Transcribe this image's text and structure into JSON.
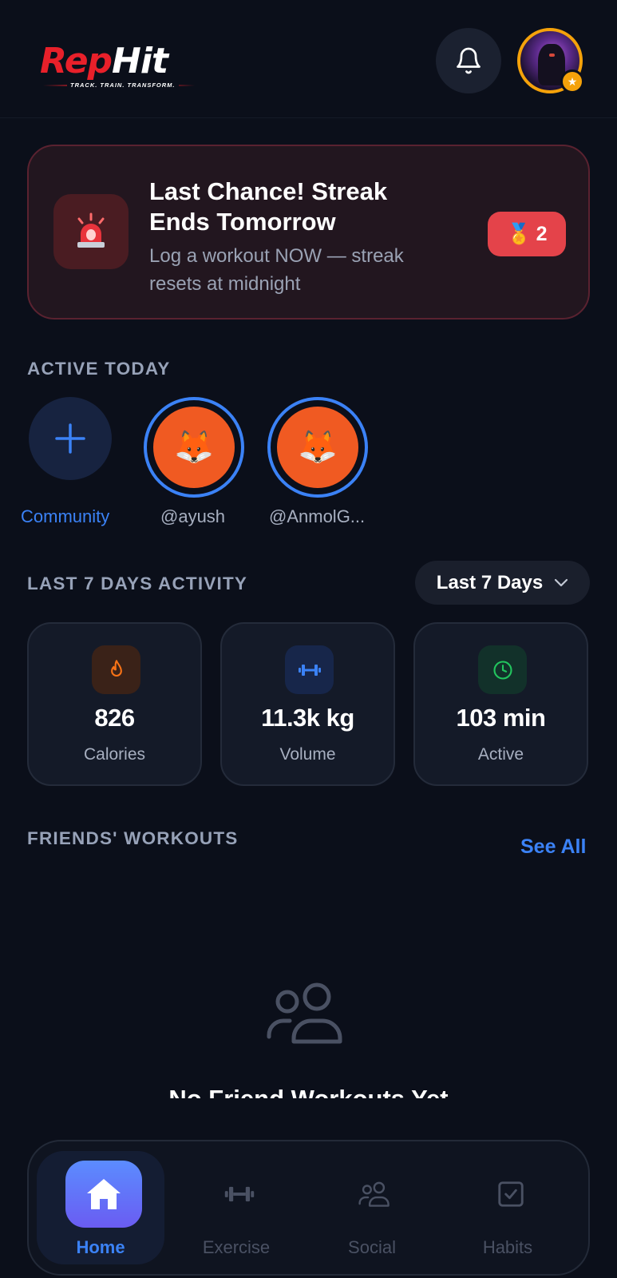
{
  "header": {
    "logo_rep": "Rep",
    "logo_hit": "Hit",
    "logo_tagline": "TRACK. TRAIN. TRANSFORM."
  },
  "alert": {
    "title": "Last Chance! Streak Ends Tomorrow",
    "subtitle": "Log a workout NOW — streak resets at midnight",
    "badge_icon": "🏅",
    "badge_count": "2"
  },
  "active_today": {
    "label": "ACTIVE TODAY",
    "stories": [
      {
        "label": "Community"
      },
      {
        "label": "@ayush",
        "emoji": "🦊"
      },
      {
        "label": "@AnmolG...",
        "emoji": "🦊"
      }
    ]
  },
  "activity": {
    "label": "LAST 7 DAYS ACTIVITY",
    "range": "Last 7 Days",
    "stats": [
      {
        "value": "826",
        "label": "Calories",
        "icon": "flame-icon",
        "color": "#f97316"
      },
      {
        "value": "11.3k kg",
        "label": "Volume",
        "icon": "dumbbell-icon",
        "color": "#3b82f6"
      },
      {
        "value": "103 min",
        "label": "Active",
        "icon": "clock-icon",
        "color": "#22c55e"
      }
    ]
  },
  "friends": {
    "label": "FRIENDS' WORKOUTS",
    "see_all": "See All",
    "empty_title": "No Friend Workouts Yet"
  },
  "nav": {
    "items": [
      {
        "label": "Home",
        "active": true
      },
      {
        "label": "Exercise",
        "active": false
      },
      {
        "label": "Social",
        "active": false
      },
      {
        "label": "Habits",
        "active": false
      }
    ]
  },
  "colors": {
    "background": "#0b0f1a",
    "accent": "#3b82f6",
    "alert": "#e4434a",
    "brand_red": "#e8202a",
    "avatar_ring": "#f5a20a"
  }
}
